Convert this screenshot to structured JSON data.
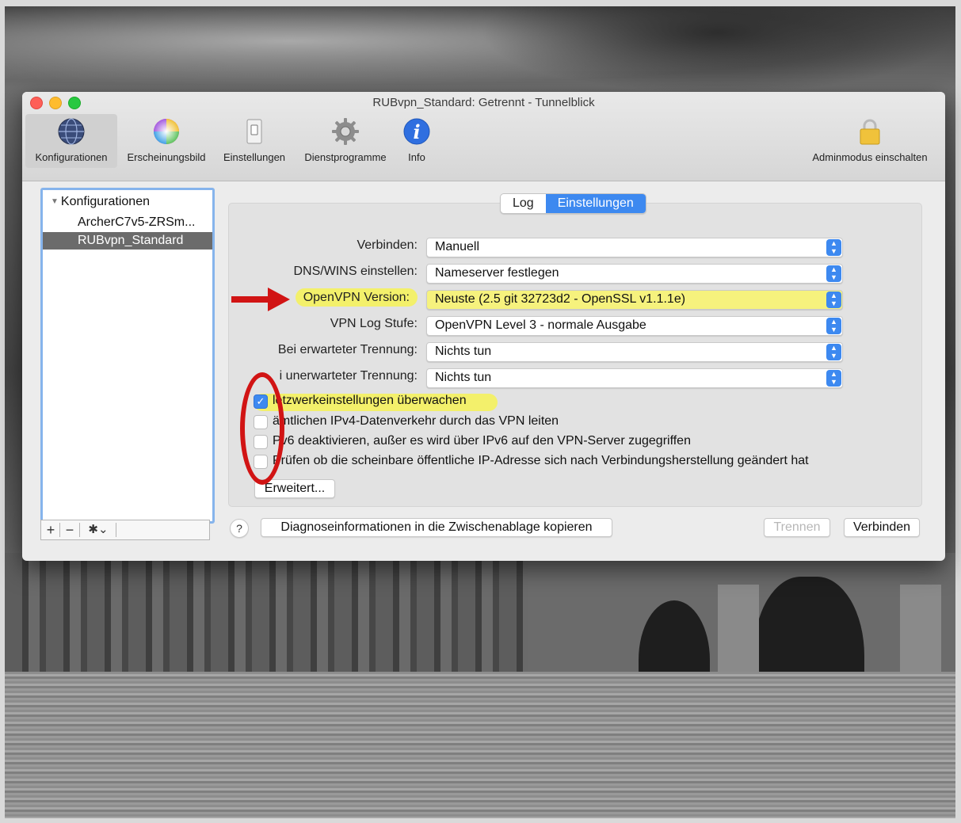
{
  "window": {
    "title": "RUBvpn_Standard: Getrennt - Tunnelblick"
  },
  "toolbar": {
    "items": [
      {
        "label": "Konfigurationen",
        "icon": "globe-icon"
      },
      {
        "label": "Erscheinungsbild",
        "icon": "color-wheel-icon"
      },
      {
        "label": "Einstellungen",
        "icon": "switch-icon"
      },
      {
        "label": "Dienstprogramme",
        "icon": "gear-icon"
      },
      {
        "label": "Info",
        "icon": "info-icon"
      }
    ],
    "admin_label": "Adminmodus einschalten",
    "admin_icon": "lock-icon"
  },
  "sidebar": {
    "header": "Konfigurationen",
    "items": [
      "ArcherC7v5-ZRSm...",
      "RUBvpn_Standard"
    ],
    "footer": {
      "add": "+",
      "remove": "−",
      "gear": "✱⌄"
    }
  },
  "tabs": {
    "log": "Log",
    "settings": "Einstellungen"
  },
  "settings": {
    "rows": [
      {
        "label": "Verbinden:",
        "value": "Manuell"
      },
      {
        "label": "DNS/WINS einstellen:",
        "value": "Nameserver festlegen"
      },
      {
        "label": "OpenVPN Version:",
        "value": "Neuste (2.5 git 32723d2 - OpenSSL v1.1.1e)"
      },
      {
        "label": "VPN Log Stufe:",
        "value": "OpenVPN Level 3 - normale Ausgabe"
      },
      {
        "label": "Bei erwarteter Trennung:",
        "value": "Nichts tun"
      },
      {
        "label": "i unerwarteter Trennung:",
        "value": "Nichts tun"
      }
    ],
    "checkboxes": [
      {
        "label": "letzwerkeinstellungen überwachen",
        "checked": true
      },
      {
        "label": "ämtlichen IPv4-Datenverkehr durch das VPN leiten",
        "checked": false
      },
      {
        "label": "Pv6 deaktivieren, außer es wird über IPv6 auf den VPN-Server zugegriffen",
        "checked": false
      },
      {
        "label": "Prüfen ob die scheinbare öffentliche IP-Adresse sich nach Verbindungsherstellung geändert hat",
        "checked": false
      }
    ],
    "advanced_button": "Erweitert..."
  },
  "bottom": {
    "help": "?",
    "copy_diag": "Diagnoseinformationen in die Zwischenablage kopieren",
    "disconnect": "Trennen",
    "connect": "Verbinden"
  },
  "colors": {
    "accent": "#3d89f0",
    "highlight": "#f3f06b",
    "annotation": "#d11414"
  }
}
